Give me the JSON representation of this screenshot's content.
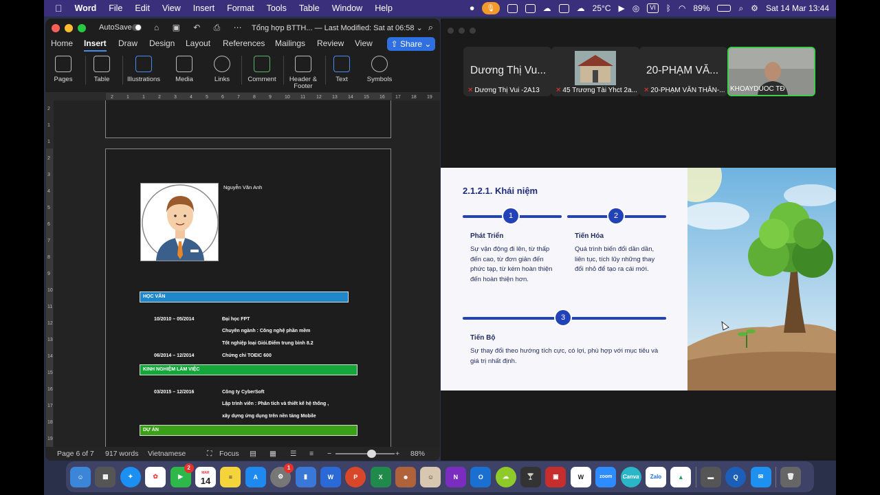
{
  "menubar": {
    "app": "Word",
    "items": [
      "File",
      "Edit",
      "View",
      "Insert",
      "Format",
      "Tools",
      "Table",
      "Window",
      "Help"
    ],
    "weather": "25°C",
    "vi_badge": "VI",
    "battery": "89%",
    "datetime": "Sat 14 Mar  13:44"
  },
  "word": {
    "autosave": "AutoSave",
    "doc_title": "Tổng hợp BTTH... — Last Modified: Sat at 06:58 ⌄",
    "tabs": [
      "Home",
      "Insert",
      "Draw",
      "Design",
      "Layout",
      "References",
      "Mailings",
      "Review",
      "View"
    ],
    "active_tab": "Insert",
    "share": "Share",
    "ribbon": [
      "Pages",
      "Table",
      "Illustrations",
      "Media",
      "Links",
      "Comment",
      "Header & Footer",
      "Text",
      "Symbols"
    ],
    "cv": {
      "name": "Nguyễn Văn Anh",
      "sections": [
        "HỌC VẤN",
        "KINH NGHIỆM LÀM VIỆC",
        "DỰ ÁN"
      ],
      "rows": [
        {
          "date": "10/2010 – 05/2014",
          "text": "Đại học FPT"
        },
        {
          "date": "",
          "text": "Chuyên ngành : Công nghệ phần mềm"
        },
        {
          "date": "",
          "text": "Tốt nghiệp loại Giỏi.Điểm trung bình 8.2"
        },
        {
          "date": "06/2014 – 12/2014",
          "text": "Chứng chỉ TOEIC 600"
        },
        {
          "date": "03/2015 – 12/2016",
          "text": "Công ty CyberSoft"
        },
        {
          "date": "",
          "text": "Lập trình viên : Phân tích và thiết kế hệ thống ,"
        },
        {
          "date": "",
          "text": "xây dựng ứng dụng trên nền tảng Mobile"
        }
      ]
    },
    "status": {
      "page": "Page 6 of 7",
      "words": "917 words",
      "language": "Vietnamese",
      "focus": "Focus",
      "zoom": "88%",
      "zoom_level": 0.6
    },
    "vruler_marks": [
      "2",
      "1",
      "1",
      "2",
      "3",
      "4",
      "5",
      "6",
      "7",
      "8",
      "9",
      "10",
      "11",
      "12",
      "13",
      "14",
      "15",
      "16",
      "17",
      "18",
      "19"
    ],
    "hruler_marks": [
      "2",
      "1",
      "1",
      "2",
      "3",
      "4",
      "5",
      "6",
      "7",
      "8",
      "9",
      "10",
      "11",
      "12",
      "13",
      "14",
      "15",
      "16",
      "17",
      "18",
      "19"
    ]
  },
  "zoom": {
    "participants": [
      {
        "big": "Dương Thị Vu...",
        "small": "Dương Thị Vui -2A13"
      },
      {
        "big": "",
        "small": "45 Trương Tài Yhct 2a..."
      },
      {
        "big": "20-PHẠM VĂ...",
        "small": "20-PHẠM VĂN THÂN-..."
      },
      {
        "big": "",
        "small": "KHOAYDUOC TĐ"
      }
    ],
    "slide": {
      "title": "2.1.2.1. Khái niệm",
      "items": [
        {
          "num": "1",
          "head": "Phát Triển",
          "text": "Sự vận động đi lên, từ thấp đến cao, từ đơn giản đến phức tạp, từ kém hoàn thiện đến hoàn thiện hơn."
        },
        {
          "num": "2",
          "head": "Tiến Hóa",
          "text": "Quá trình biến đổi dần dần, liên tục, tích lũy những thay đổi nhỏ để tạo ra cái mới."
        },
        {
          "num": "3",
          "head": "Tiến Bộ",
          "text": "Sự thay đổi theo hướng tích cực, có lợi, phù hợp với mục tiêu và giá trị nhất định."
        }
      ]
    }
  },
  "dock": {
    "calendar_month": "MAR",
    "calendar_day": "14",
    "facetime_badge": "2",
    "settings_badge": "1",
    "zoom_label": "zoom",
    "canva_label": "Canva",
    "zalo_label": "Zalo"
  }
}
